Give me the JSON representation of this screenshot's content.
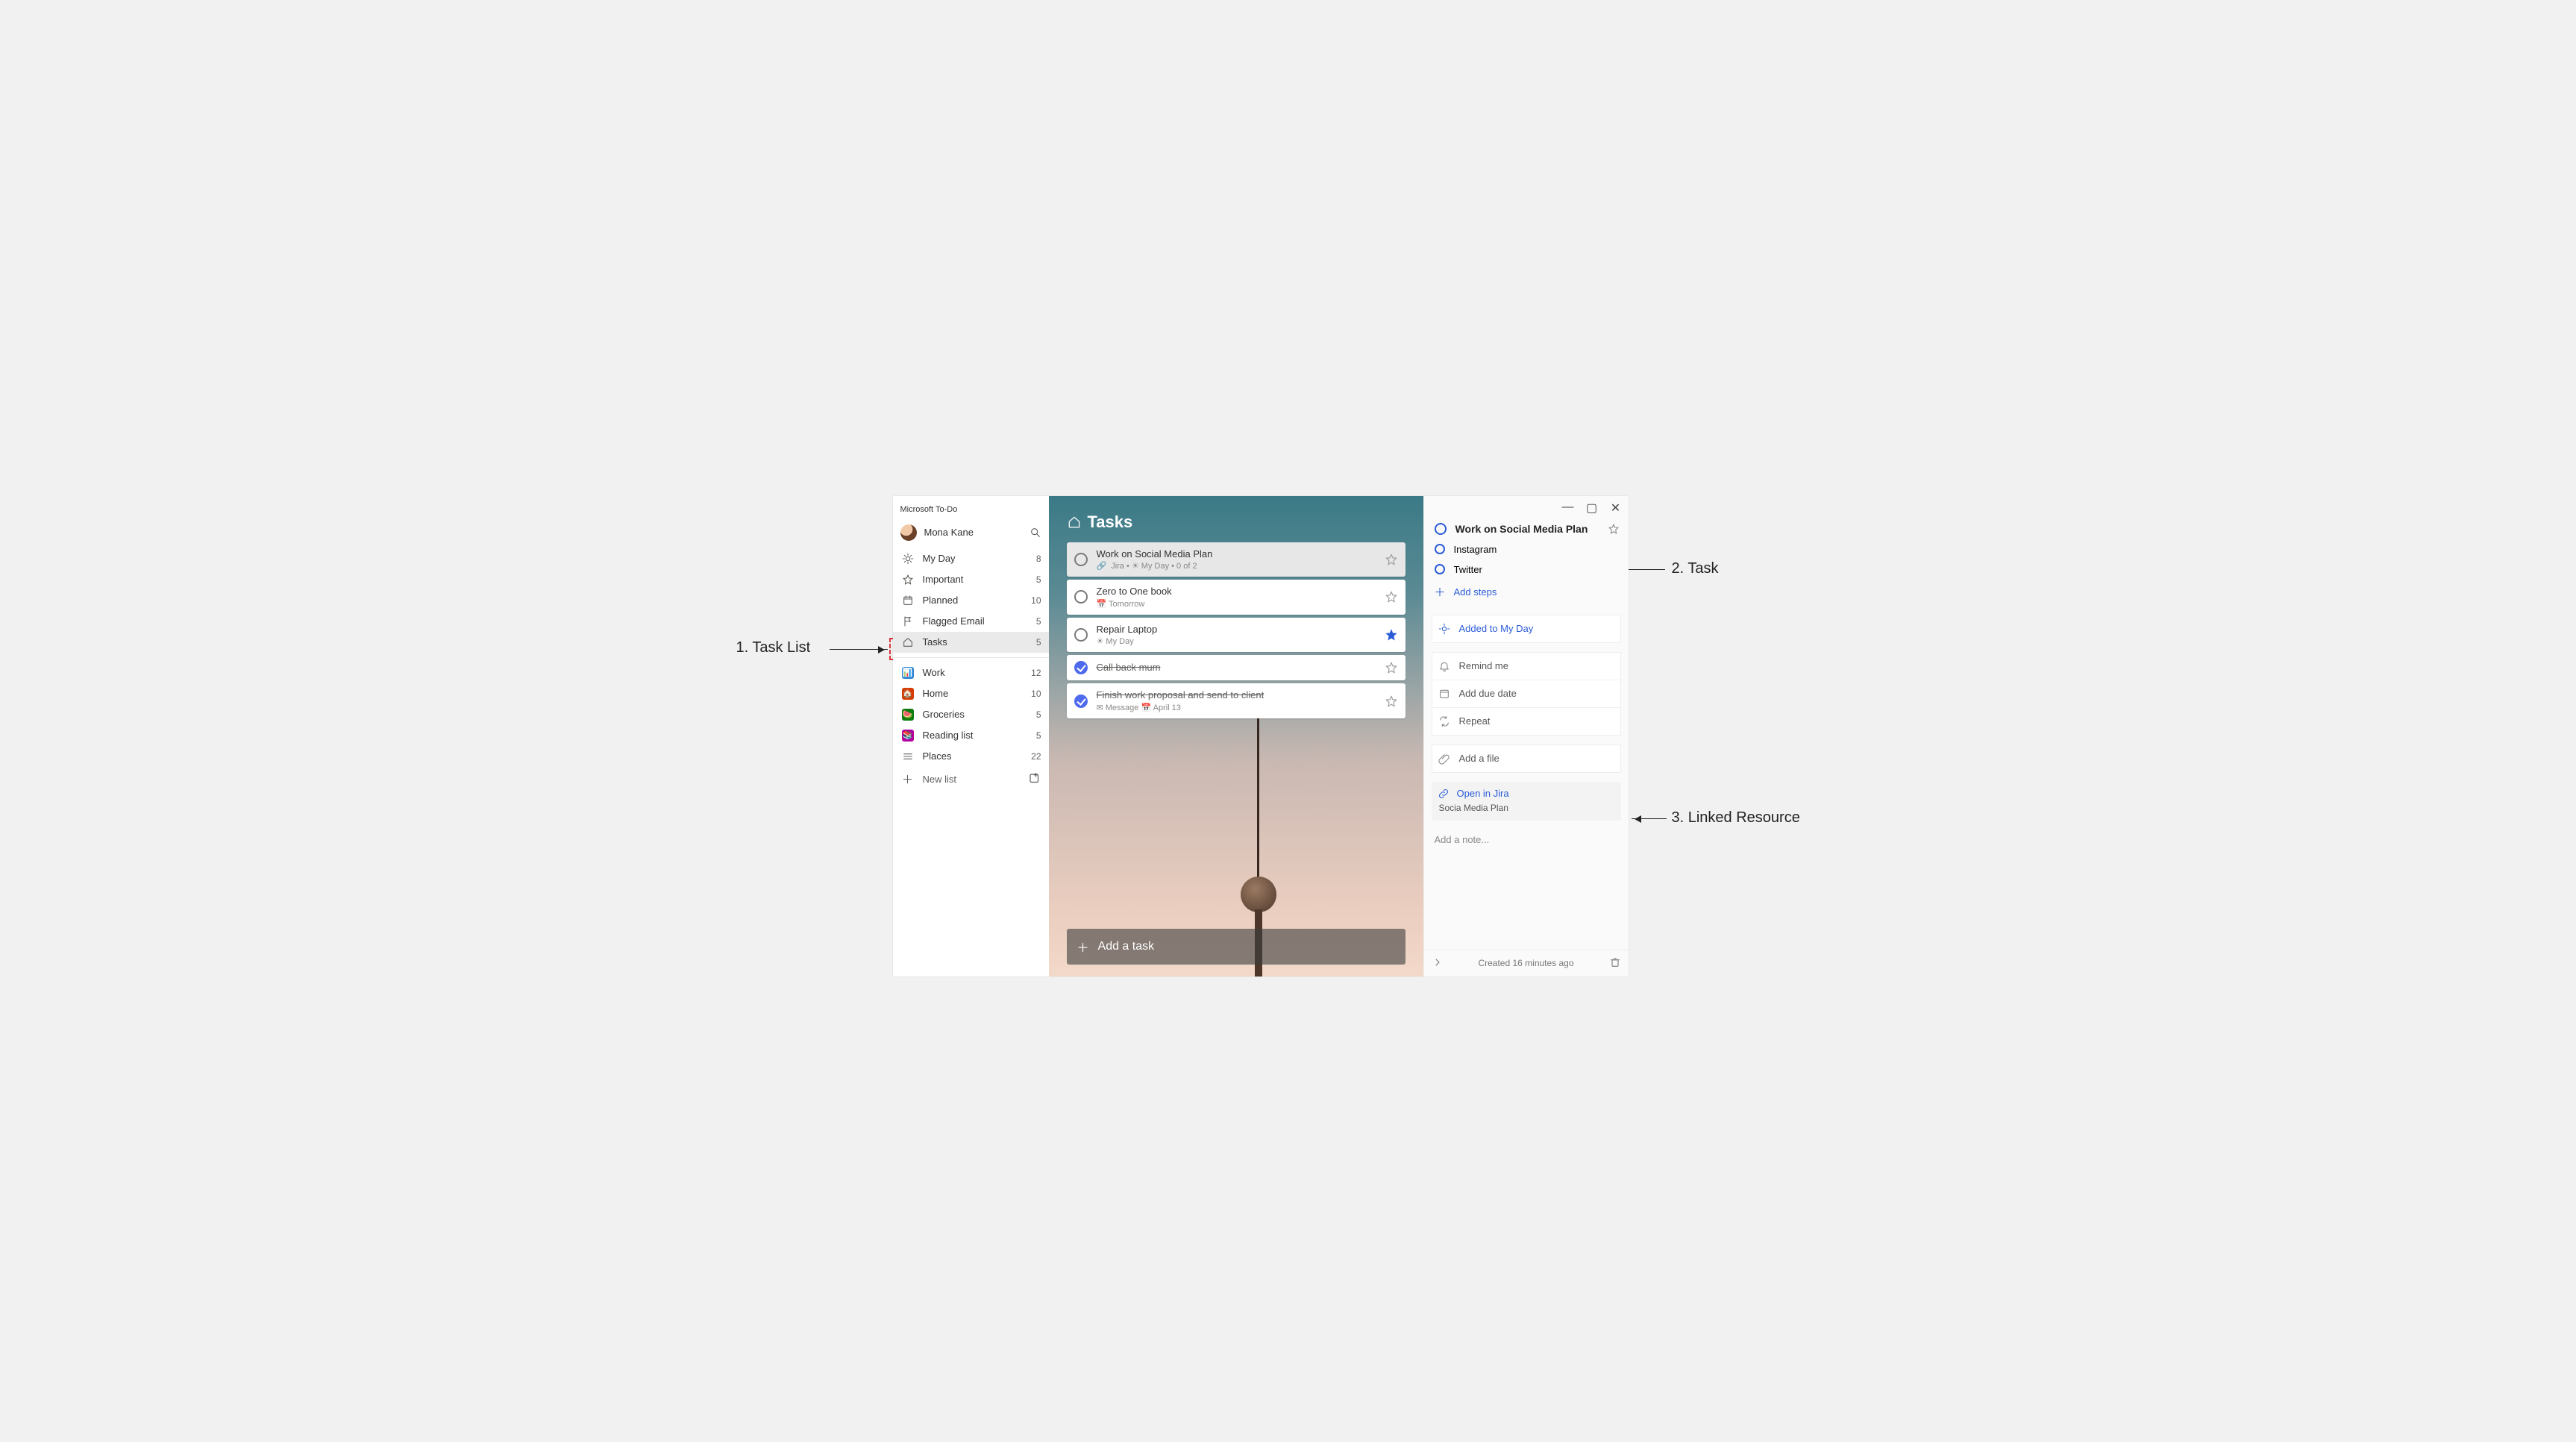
{
  "callouts": {
    "c1": "1. Task List",
    "c2": "2. Task",
    "c3": "3. Linked Resource"
  },
  "app": {
    "title": "Microsoft To-Do"
  },
  "profile": {
    "name": "Mona Kane"
  },
  "smartLists": [
    {
      "label": "My Day",
      "count": "8"
    },
    {
      "label": "Important",
      "count": "5"
    },
    {
      "label": "Planned",
      "count": "10"
    },
    {
      "label": "Flagged Email",
      "count": "5"
    },
    {
      "label": "Tasks",
      "count": "5"
    }
  ],
  "userLists": [
    {
      "label": "Work",
      "count": "12"
    },
    {
      "label": "Home",
      "count": "10"
    },
    {
      "label": "Groceries",
      "count": "5"
    },
    {
      "label": "Reading list",
      "count": "5"
    },
    {
      "label": "Places",
      "count": "22"
    }
  ],
  "newList": {
    "label": "New list"
  },
  "main": {
    "title": "Tasks",
    "addTask": "Add a task",
    "tasks": [
      {
        "title": "Work on Social Media Plan",
        "meta": "Jira  •  ☀ My Day  •  0 of 2",
        "done": false,
        "star": false,
        "selected": true
      },
      {
        "title": "Zero to One book",
        "meta": "📅 Tomorrow",
        "done": false,
        "star": false
      },
      {
        "title": "Repair Laptop",
        "meta": "☀ My Day",
        "done": false,
        "star": true
      },
      {
        "title": "Call back mum",
        "meta": "",
        "done": true,
        "star": false
      },
      {
        "title": "Finish work proposal and send to client",
        "meta": "✉ Message   📅 April 13",
        "done": true,
        "star": false
      }
    ]
  },
  "details": {
    "title": "Work on Social Media Plan",
    "steps": [
      {
        "label": "Instagram"
      },
      {
        "label": "Twitter"
      }
    ],
    "addSteps": "Add steps",
    "myDay": "Added to My Day",
    "remind": "Remind me",
    "due": "Add due date",
    "repeat": "Repeat",
    "file": "Add a file",
    "link": {
      "open": "Open in Jira",
      "name": "Socia Media Plan"
    },
    "notePlaceholder": "Add a note...",
    "created": "Created 16 minutes ago"
  }
}
